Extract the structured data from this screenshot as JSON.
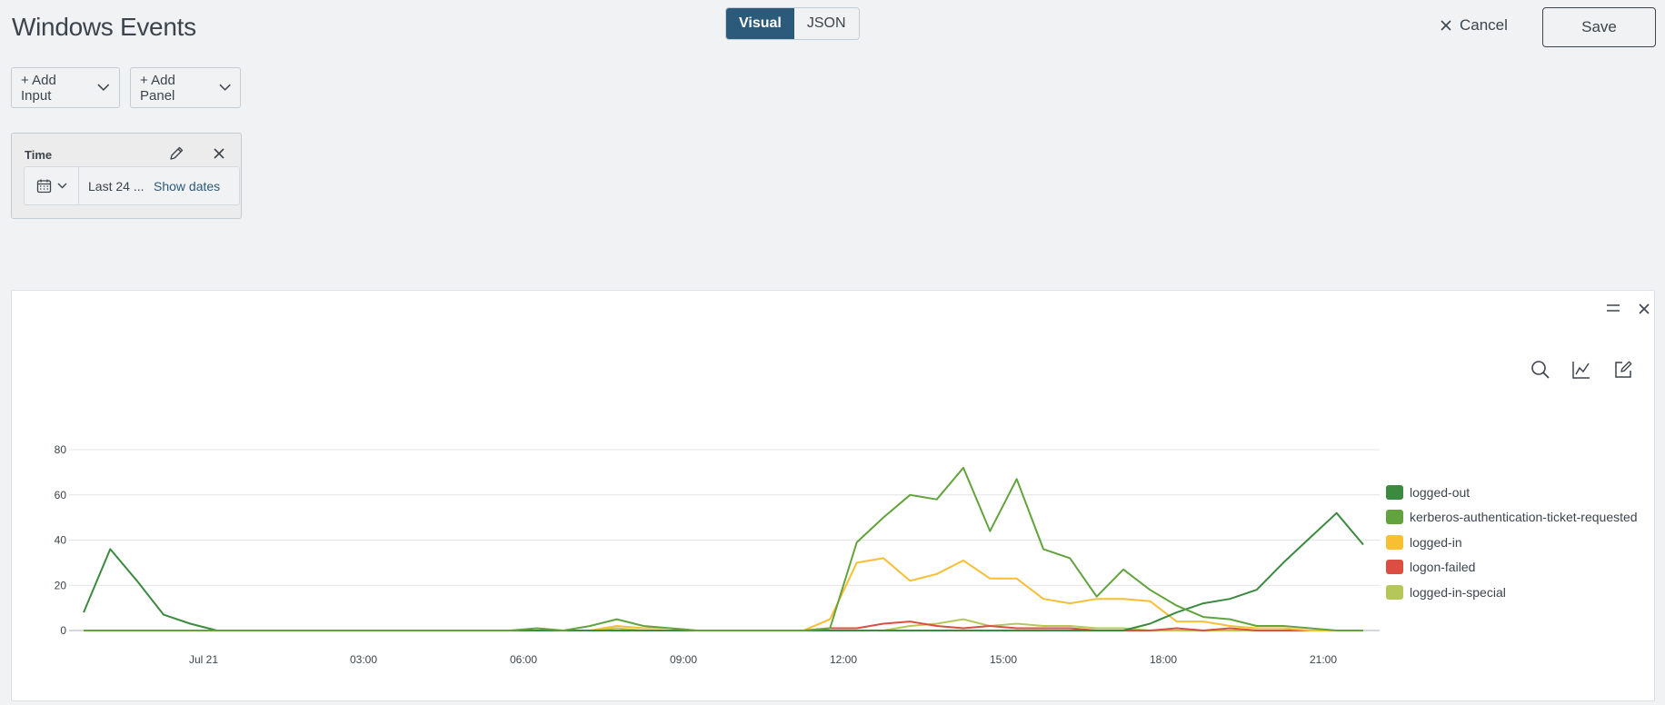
{
  "header": {
    "title": "Windows Events",
    "mode_visual": "Visual",
    "mode_json": "JSON",
    "cancel_label": "Cancel",
    "save_label": "Save"
  },
  "toolbar": {
    "add_input_label": "+ Add Input",
    "add_panel_label": "+ Add Panel"
  },
  "time_input": {
    "label": "Time",
    "range_label": "Last 24 ...",
    "show_dates_label": "Show dates"
  },
  "colors": {
    "accent": "#2c5a7a",
    "logged-out": "#3b8a3f",
    "kerberos-authentication-ticket-requested": "#62a33d",
    "logged-in": "#f8be34",
    "logon-failed": "#dc4e41",
    "logged-in-special": "#b6c75a"
  },
  "icons": {
    "cancel": "close-icon",
    "calendar": "calendar-icon",
    "edit": "pencil-icon",
    "panel_menu": "hamburger-icon",
    "zoom": "search-icon",
    "visualization": "line-chart-icon",
    "edit_search": "edit-icon"
  },
  "chart_data": {
    "type": "line",
    "title": "",
    "xlabel": "",
    "ylabel": "",
    "ylim": [
      0,
      80
    ],
    "yticks": [
      "0",
      "20",
      "40",
      "60",
      "80"
    ],
    "x_tick_labels": [
      "Jul 21",
      "03:00",
      "06:00",
      "09:00",
      "12:00",
      "15:00",
      "18:00",
      "21:00"
    ],
    "x_tick_hours": [
      0,
      3,
      6,
      9,
      12,
      15,
      18,
      21
    ],
    "x": [
      -2.25,
      -1.75,
      -1.25,
      -0.75,
      -0.25,
      0.25,
      0.75,
      1.25,
      1.75,
      2.25,
      2.75,
      3.25,
      3.75,
      4.25,
      4.75,
      5.25,
      5.75,
      6.25,
      6.75,
      7.25,
      7.75,
      8.25,
      8.75,
      9.25,
      9.75,
      10.25,
      10.75,
      11.25,
      11.75,
      12.25,
      12.75,
      13.25,
      13.75,
      14.25,
      14.75,
      15.25,
      15.75,
      16.25,
      16.75,
      17.25,
      17.75,
      18.25,
      18.75,
      19.25,
      19.75,
      20.25,
      20.75,
      21.25,
      21.75
    ],
    "grid": true,
    "legend_position": "right",
    "series": [
      {
        "name": "logged-out",
        "color": "#3b8a3f",
        "values": [
          8,
          36,
          22,
          7,
          3,
          0,
          0,
          0,
          0,
          0,
          0,
          0,
          0,
          0,
          0,
          0,
          0,
          0,
          0,
          0,
          0,
          0,
          0,
          0,
          0,
          0,
          0,
          0,
          0,
          0,
          0,
          0,
          0,
          0,
          0,
          0,
          0,
          0,
          0,
          0,
          3,
          8,
          12,
          14,
          18,
          30,
          41,
          52,
          38
        ]
      },
      {
        "name": "kerberos-authentication-ticket-requested",
        "color": "#62a33d",
        "values": [
          0,
          0,
          0,
          0,
          0,
          0,
          0,
          0,
          0,
          0,
          0,
          0,
          0,
          0,
          0,
          0,
          0,
          1,
          0,
          2,
          5,
          2,
          1,
          0,
          0,
          0,
          0,
          0,
          1,
          39,
          50,
          60,
          58,
          72,
          44,
          67,
          36,
          32,
          15,
          27,
          18,
          11,
          6,
          5,
          2,
          2,
          1,
          0,
          0
        ]
      },
      {
        "name": "logged-in",
        "color": "#f8be34",
        "values": [
          0,
          0,
          0,
          0,
          0,
          0,
          0,
          0,
          0,
          0,
          0,
          0,
          0,
          0,
          0,
          0,
          0,
          0,
          0,
          0,
          2,
          1,
          1,
          0,
          0,
          0,
          0,
          0,
          5,
          30,
          32,
          22,
          25,
          31,
          23,
          23,
          14,
          12,
          14,
          14,
          13,
          4,
          4,
          2,
          1,
          1,
          0,
          0,
          0
        ]
      },
      {
        "name": "logon-failed",
        "color": "#dc4e41",
        "values": [
          0,
          0,
          0,
          0,
          0,
          0,
          0,
          0,
          0,
          0,
          0,
          0,
          0,
          0,
          0,
          0,
          0,
          0,
          0,
          0,
          0,
          0,
          0,
          0,
          0,
          0,
          0,
          0,
          1,
          1,
          3,
          4,
          2,
          1,
          2,
          1,
          1,
          1,
          0,
          0,
          0,
          1,
          0,
          1,
          0,
          0,
          0,
          0,
          0
        ]
      },
      {
        "name": "logged-in-special",
        "color": "#b6c75a",
        "values": [
          0,
          0,
          0,
          0,
          0,
          0,
          0,
          0,
          0,
          0,
          0,
          0,
          0,
          0,
          0,
          0,
          0,
          0,
          0,
          0,
          1,
          0,
          0,
          0,
          0,
          0,
          0,
          0,
          0,
          0,
          0,
          2,
          3,
          5,
          2,
          3,
          2,
          2,
          1,
          1,
          0,
          0,
          0,
          0,
          0,
          0,
          0,
          0,
          0
        ]
      }
    ]
  }
}
